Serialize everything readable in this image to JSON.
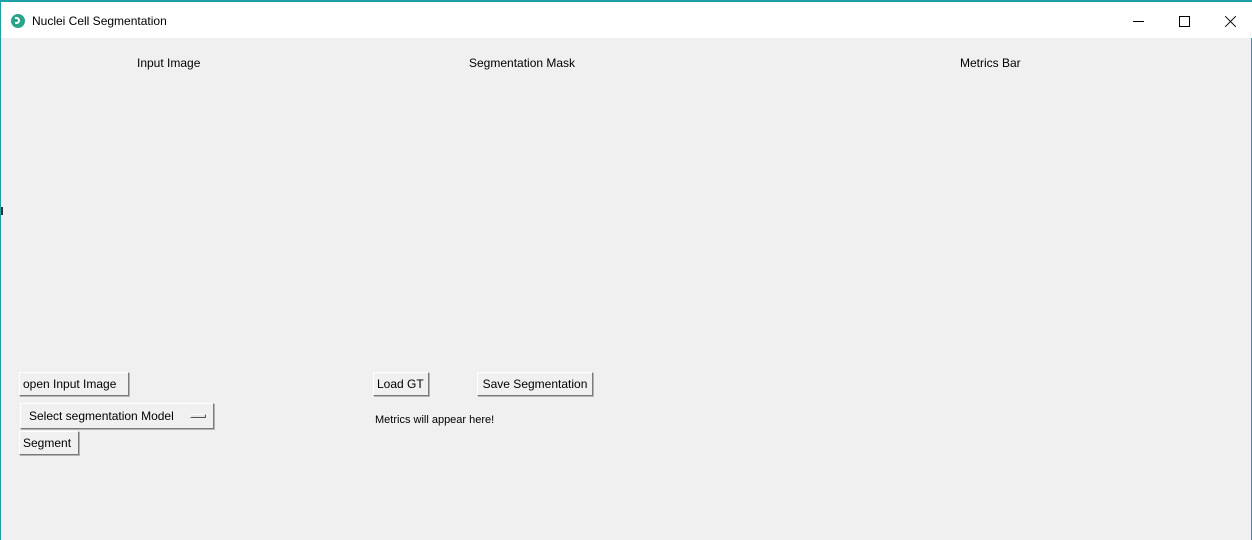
{
  "window": {
    "title": "Nuclei Cell Segmentation",
    "accent_color": "#1e9fa8",
    "icon": "app-logo-icon",
    "controls": {
      "minimize_icon": "minimize-icon",
      "maximize_icon": "maximize-icon",
      "close_icon": "close-icon"
    }
  },
  "headings": {
    "input": "Input Image",
    "segmentation": "Segmentation Mask",
    "metrics": "Metrics Bar"
  },
  "buttons": {
    "open_input": "open Input Image",
    "load_gt": "Load GT",
    "save_segmentation": "Save Segmentation",
    "segment": "Segment"
  },
  "model_menu": {
    "selected": "Select segmentation Model"
  },
  "metrics_text": "Metrics will appear here!"
}
